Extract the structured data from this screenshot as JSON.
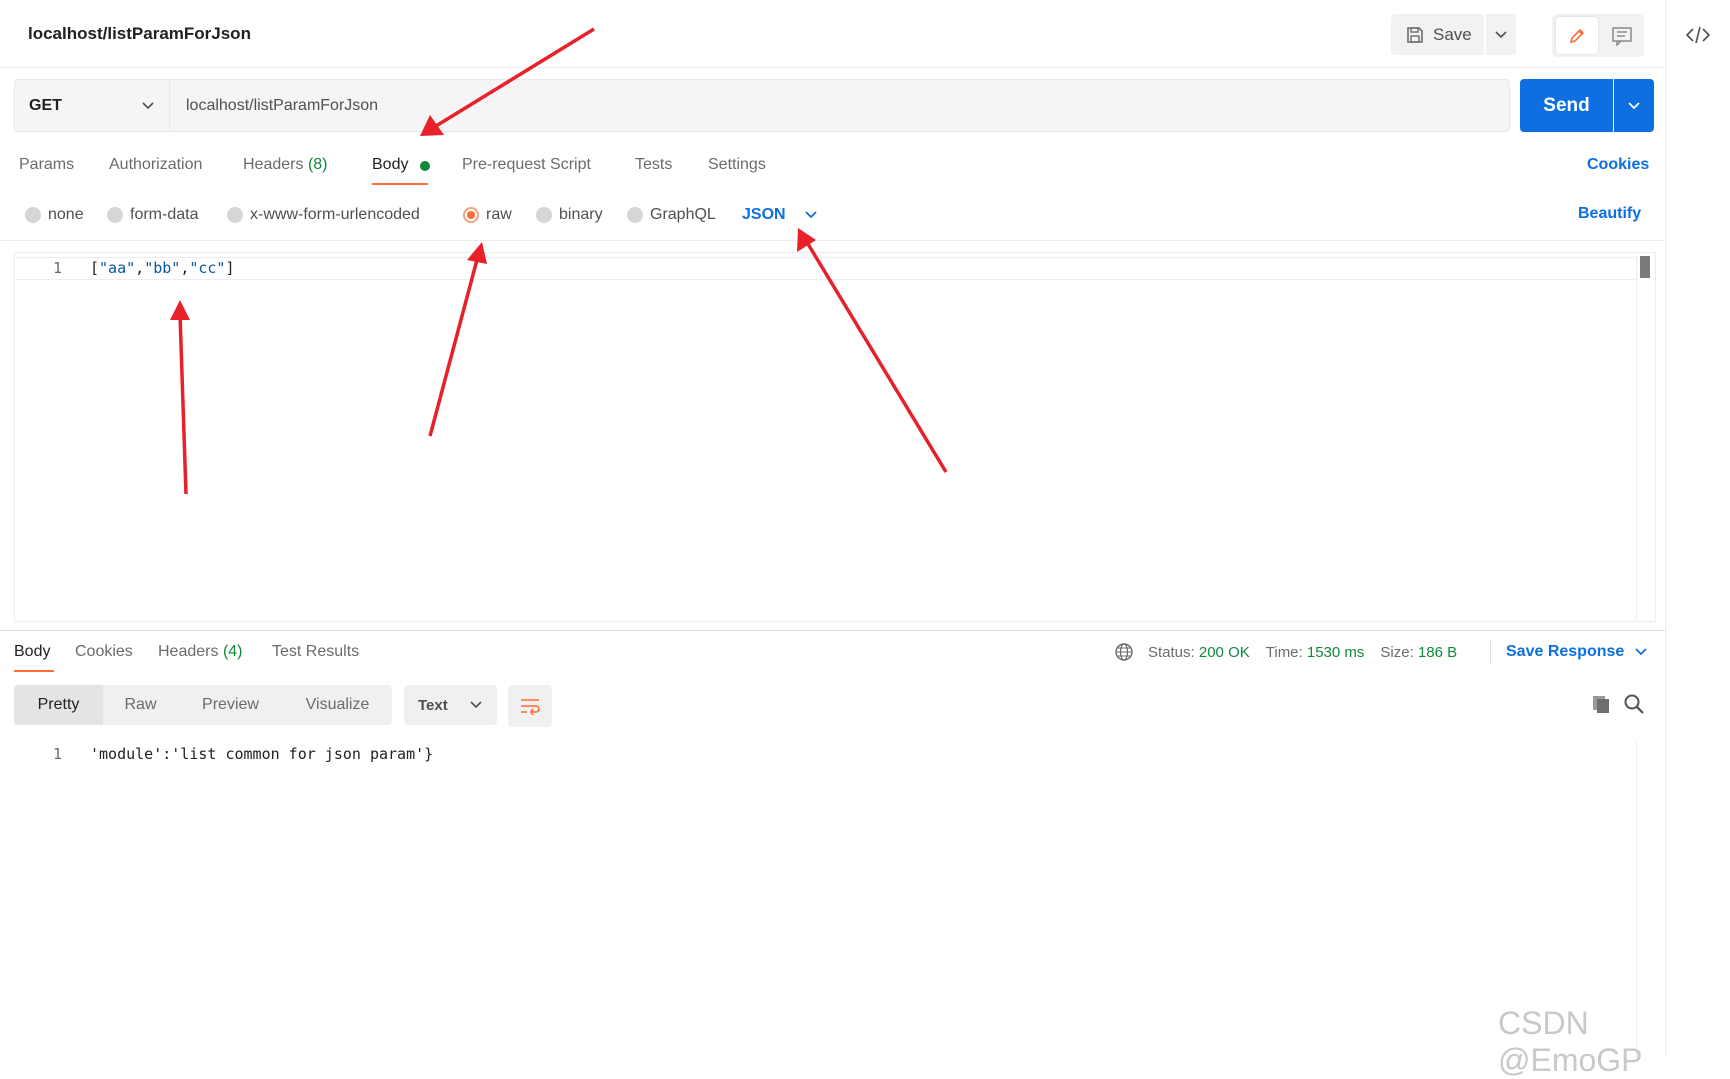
{
  "request": {
    "title": "localhost/listParamForJson",
    "save_label": "Save",
    "method": "GET",
    "url": "localhost/listParamForJson",
    "send_label": "Send"
  },
  "request_tabs": {
    "params": "Params",
    "authorization": "Authorization",
    "headers_label": "Headers",
    "headers_count": "(8)",
    "body": "Body",
    "pre_request": "Pre-request Script",
    "tests": "Tests",
    "settings": "Settings",
    "cookies": "Cookies"
  },
  "body_types": {
    "none": "none",
    "form_data": "form-data",
    "urlencoded": "x-www-form-urlencoded",
    "raw": "raw",
    "binary": "binary",
    "graphql": "GraphQL",
    "selected": "raw",
    "language": "JSON",
    "beautify": "Beautify"
  },
  "request_body": {
    "line_number": "1",
    "open": "[",
    "s1": "\"aa\"",
    "c1": ",",
    "s2": "\"bb\"",
    "c2": ",",
    "s3": "\"cc\"",
    "close": "]"
  },
  "response_tabs": {
    "body": "Body",
    "cookies": "Cookies",
    "headers_label": "Headers",
    "headers_count": "(4)",
    "test_results": "Test Results"
  },
  "response_status": {
    "status_label": "Status:",
    "status_value": "200 OK",
    "time_label": "Time:",
    "time_value": "1530 ms",
    "size_label": "Size:",
    "size_value": "186 B",
    "save_response": "Save Response"
  },
  "response_view": {
    "pretty": "Pretty",
    "raw": "Raw",
    "preview": "Preview",
    "visualize": "Visualize",
    "format": "Text"
  },
  "response_body": {
    "line_number": "1",
    "content": "'module':'list common for json param'}"
  },
  "watermark": "CSDN @EmoGP",
  "colors": {
    "accent_orange": "#ff6c37",
    "send_blue": "#0d6fe0",
    "success_green": "#0f8a3a",
    "annotation_arrow": "#e8202a"
  }
}
